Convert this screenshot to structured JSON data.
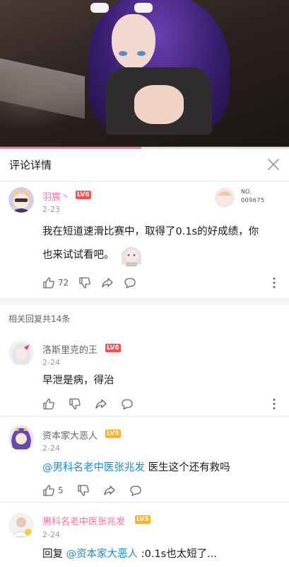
{
  "video": {
    "progress": 0.49
  },
  "header": {
    "title": "评论详情"
  },
  "main_comment": {
    "username": "羽宸丶",
    "level": "LV6",
    "date": "2-23",
    "text_line1": "我在短道速滑比赛中，取得了0.1s的好成绩，你",
    "text_line2": "也来试试看吧。",
    "like_count": "72",
    "badge_text": "NO.",
    "badge_number": "009675"
  },
  "replies_header": "相关回复共14条",
  "replies": [
    {
      "username": "洛斯里克的王",
      "level": "LV6",
      "date": "2-24",
      "text": "早泄是病，得治",
      "like_count": ""
    },
    {
      "username": "资本家大恶人",
      "level": "LV5",
      "date": "2-24",
      "mention": "@男科名老中医张兆发",
      "text": " 医生这个还有救吗",
      "like_count": "5"
    },
    {
      "username": "男科名老中医张兆发",
      "level": "LV5",
      "date": "2-24",
      "prefix": "回复 ",
      "mention": "@资本家大恶人",
      "text": " :0.1s也太短了..."
    }
  ],
  "colors": {
    "accent": "#fb7299",
    "link": "#178bcf",
    "lv6": "#ff4d4d",
    "lv5": "#ffb027"
  },
  "icons": [
    "close-icon",
    "like-icon",
    "dislike-icon",
    "share-icon",
    "reply-icon",
    "more-icon"
  ]
}
